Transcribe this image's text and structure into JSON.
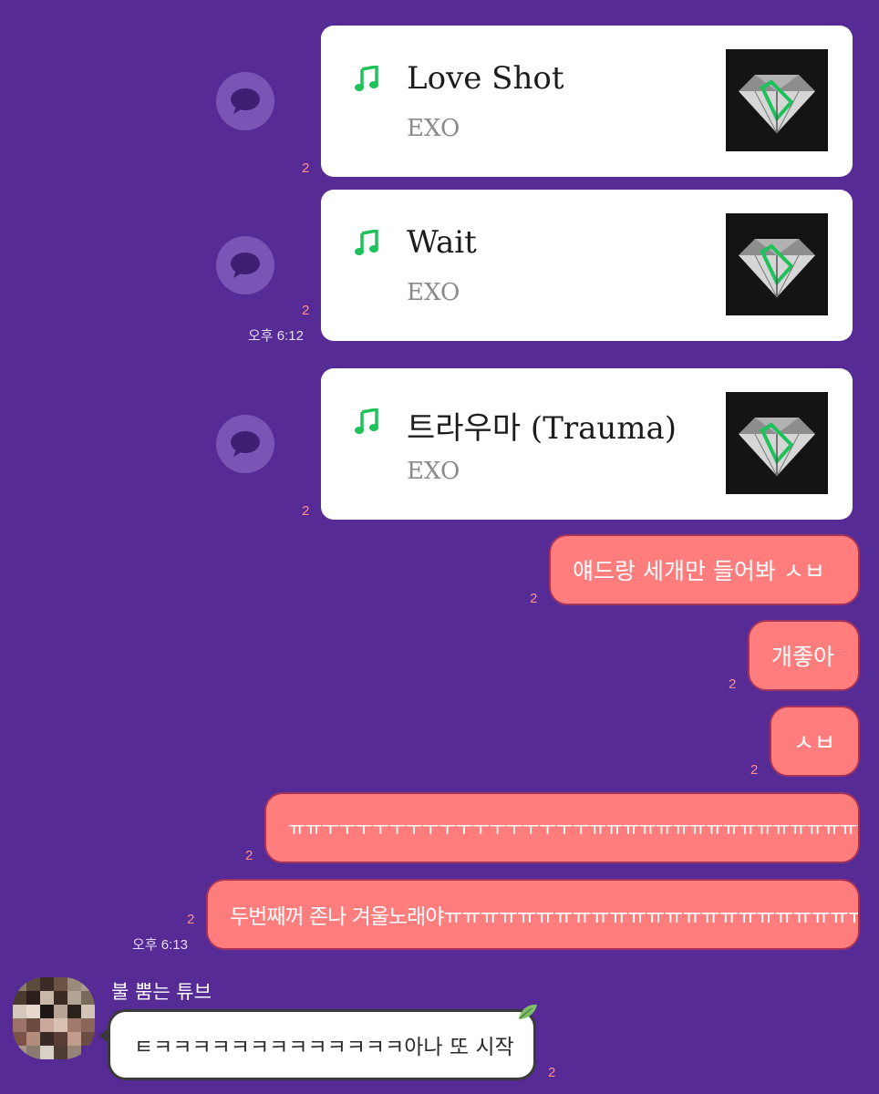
{
  "songs": [
    {
      "title": "Love Shot",
      "artist": "EXO",
      "read_count": "2"
    },
    {
      "title": "Wait",
      "artist": "EXO",
      "read_count": "2"
    },
    {
      "title": "트라우마 (Trauma)",
      "artist": "EXO",
      "read_count": "2"
    }
  ],
  "timestamps": {
    "first": "오후 6:12",
    "second": "오후 6:13"
  },
  "outgoing": [
    {
      "text": "얘드랑 세개만 들어봐 ㅅㅂ",
      "read_count": "2"
    },
    {
      "text": "개좋아",
      "read_count": "2"
    },
    {
      "text": "ㅅㅂ",
      "read_count": "2"
    },
    {
      "text": "ㅠㅠㅜㅜㅜㅜㅜㅜㅜㅜㅜㅜㅜㅜㅜㅜㅜㅜㅠㅠㅠㅠㅠㅠㅠㅠㅠㅠㅠㅠㅠㅠㅠㅠㅠㅠㅠ",
      "read_count": "2"
    },
    {
      "text": "두번째꺼 존나 겨울노래야ㅠㅠㅠㅠㅠㅠㅠㅠㅠㅠㅠㅠㅠㅠㅠㅠㅠㅠㅠㅠㅠㅠㅠ",
      "read_count": "2"
    }
  ],
  "incoming": {
    "sender": "불 뿜는 튜브",
    "text": "ㅌㅋㅋㅋㅋㅋㅋㅋㅋㅋㅋㅋㅋㅋ아나 또 시작",
    "read_count": "2"
  },
  "colors": {
    "background": "#562b96",
    "outgoing_bubble": "#ff7d7d",
    "music_note": "#1ec15a",
    "read_count": "#ff8f8f"
  },
  "icons": {
    "share": "speech-bubble-icon",
    "note": "music-note-icon",
    "leaf": "leaf-icon"
  }
}
